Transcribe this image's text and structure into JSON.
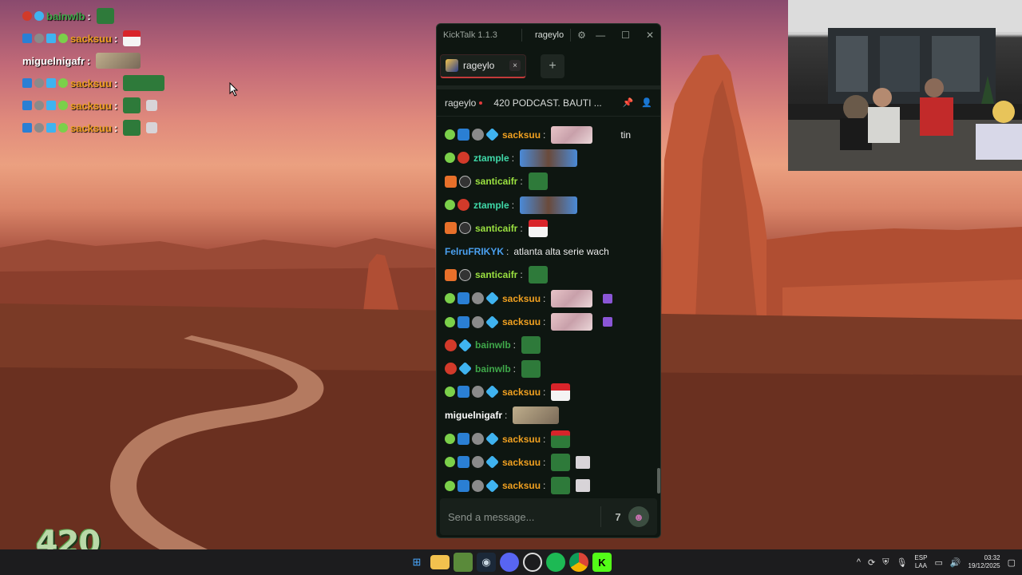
{
  "overlay_chat": [
    {
      "name": "bainwlb",
      "color": "#3fa84a"
    },
    {
      "name": "sacksuu",
      "color": "#f0a020"
    },
    {
      "name": "miguelnigafr",
      "color": "#ffffff"
    },
    {
      "name": "sacksuu",
      "color": "#f0a020"
    },
    {
      "name": "sacksuu",
      "color": "#f0a020"
    },
    {
      "name": "sacksuu",
      "color": "#f0a020"
    }
  ],
  "window": {
    "app_version": "KickTalk 1.1.3",
    "channel": "rageylo",
    "settings_icon": "gear-icon",
    "minimize_icon": "minimize-icon",
    "maximize_icon": "maximize-icon",
    "close_icon": "close-icon"
  },
  "tabs": [
    {
      "label": "rageylo",
      "close": "×"
    }
  ],
  "add_tab": "+",
  "channel_header": {
    "name": "rageylo",
    "title": "420 PODCAST. BAUTI ..."
  },
  "messages": [
    {
      "user": "sacksuu",
      "color": "#f0a020",
      "text": "tin"
    },
    {
      "user": "ztample",
      "color": "#3fd8a8",
      "text": ""
    },
    {
      "user": "santicaifr",
      "color": "#9ae040",
      "text": ""
    },
    {
      "user": "ztample",
      "color": "#3fd8a8",
      "text": ""
    },
    {
      "user": "santicaifr",
      "color": "#9ae040",
      "text": ""
    },
    {
      "user": "FelruFRIKYK",
      "color": "#4aa0f0",
      "text": "atlanta alta serie wach"
    },
    {
      "user": "santicaifr",
      "color": "#9ae040",
      "text": ""
    },
    {
      "user": "sacksuu",
      "color": "#f0a020",
      "text": ""
    },
    {
      "user": "sacksuu",
      "color": "#f0a020",
      "text": ""
    },
    {
      "user": "bainwlb",
      "color": "#3fa84a",
      "text": ""
    },
    {
      "user": "bainwlb",
      "color": "#3fa84a",
      "text": ""
    },
    {
      "user": "sacksuu",
      "color": "#f0a020",
      "text": ""
    },
    {
      "user": "miguelnigafr",
      "color": "#ffffff",
      "text": ""
    },
    {
      "user": "sacksuu",
      "color": "#f0a020",
      "text": ""
    },
    {
      "user": "sacksuu",
      "color": "#f0a020",
      "text": ""
    },
    {
      "user": "sacksuu",
      "color": "#f0a020",
      "text": ""
    }
  ],
  "input": {
    "placeholder": "Send a message..."
  },
  "logo": {
    "text": "420"
  },
  "taskbar": {
    "apps": [
      "windows-start-icon",
      "file-explorer-icon",
      "minecraft-icon",
      "steam-icon",
      "discord-icon",
      "obs-icon",
      "spotify-icon",
      "chrome-icon",
      "kick-icon"
    ],
    "lang_top": "ESP",
    "lang_bottom": "LAA",
    "time": "03:32",
    "date": "19/12/2025"
  }
}
